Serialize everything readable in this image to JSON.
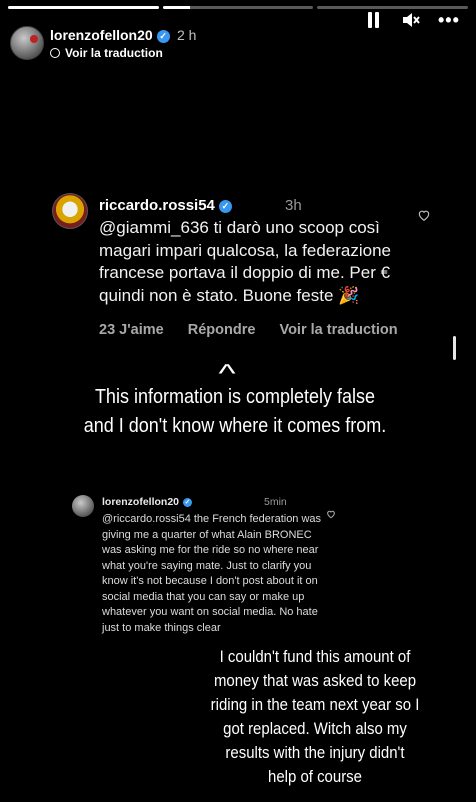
{
  "story": {
    "progress": [
      1,
      0.18,
      0
    ],
    "username": "lorenzofellon20",
    "time": "2 h",
    "translate_label": "Voir la traduction",
    "icons": [
      "pause-icon",
      "mute-icon",
      "more-icon",
      "verified-icon"
    ]
  },
  "comment": {
    "username": "riccardo.rossi54",
    "time": "3h",
    "text": "@giammi_636 ti darò uno scoop così magari impari qualcosa, la federazione francese portava il doppio di me. Per € quindi non è stato. Buone feste 🎉",
    "likes": "23 J'aime",
    "reply_label": "Répondre",
    "translate_label": "Voir la traduction"
  },
  "caption_1": "This information is completely false and I don't know where it comes from.",
  "reply": {
    "username": "lorenzofellon20",
    "time": "5min",
    "text": "@riccardo.rossi54 the French federation was giving me a quarter of what Alain BRONEC was asking me for the ride so no where near what you're saying mate. Just to clarify you know it's not because I don't post about it on social media that you can say or make up whatever you want on social media. No hate just to make things clear"
  },
  "caption_2": "I couldn't fund this amount of money that was asked to keep riding in the team next year so I got replaced. Witch also my results with the injury didn't help of course",
  "colors": {
    "verified": "#3897f0",
    "background": "#000000",
    "muted": "#a8a8a8"
  }
}
